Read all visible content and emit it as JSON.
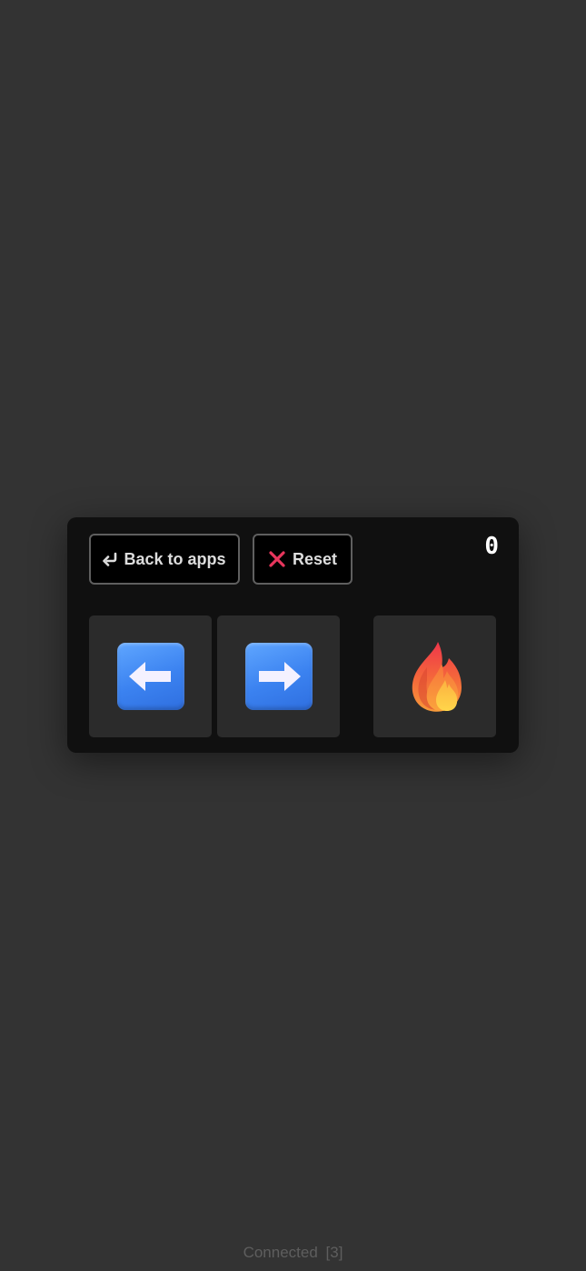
{
  "toolbar": {
    "back_label": "Back to apps",
    "back_icon": "return-arrow-icon",
    "reset_label": "Reset",
    "reset_icon": "cross-mark-icon",
    "reset_icon_color": "#e8365d"
  },
  "counter": {
    "value": "0"
  },
  "controls": {
    "left_icon": "left-arrow-icon",
    "right_icon": "right-arrow-icon",
    "fire_icon": "fire-icon",
    "arrow_color": "#3b82f0"
  },
  "status": {
    "text": "Connected  [3]"
  },
  "colors": {
    "background": "#333333",
    "panel": "#101010",
    "tile": "#2b2b2b"
  }
}
